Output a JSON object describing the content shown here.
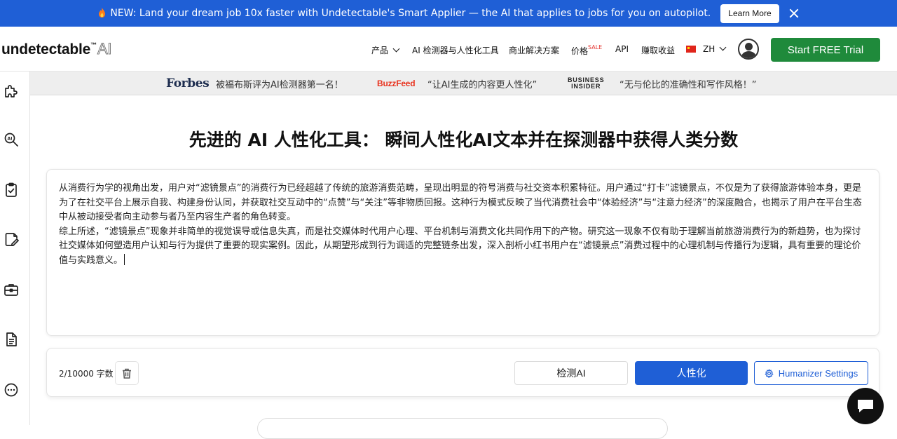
{
  "announcement": {
    "text": "NEW: Land your dream job 10x faster with Undetectable's Smart Applier — the AI that applies to jobs for you on autopilot.",
    "learn_more": "Learn More"
  },
  "header": {
    "logo_main": "undetectable",
    "logo_tm": "™",
    "logo_ai": "AI",
    "nav": {
      "products": "产品",
      "ai_tools": "AI 检测器与人性化工具",
      "business": "商业解决方案",
      "pricing": "价格",
      "sale": "SALE",
      "api": "API",
      "earn": "赚取收益",
      "lang": "ZH"
    },
    "trial_button": "Start FREE Trial"
  },
  "press": {
    "forbes_logo": "Forbes",
    "forbes_quote": "被福布斯评为AI检测器第一名！",
    "buzzfeed_logo": "BuzzFeed",
    "buzzfeed_quote": "“让AI生成的内容更人性化”",
    "bi_logo_line1": "BUSINESS",
    "bi_logo_line2": "INSIDER",
    "bi_quote": "“无与伦比的准确性和写作风格！”"
  },
  "main": {
    "title": "先进的 AI 人性化工具： 瞬间人性化AI文本并在探测器中获得人类分数",
    "editor_text_p1": "从消费行为学的视角出发，用户对“滤镜景点”的消费行为已经超越了传统的旅游消费范畴，呈现出明显的符号消费与社交资本积累特征。用户通过“打卡”滤镜景点，不仅是为了获得旅游体验本身，更是为了在社交平台上展示自我、构建身份认同，并获取社交互动中的“点赞”与“关注”等非物质回报。这种行为模式反映了当代消费社会中“体验经济”与“注意力经济”的深度融合，也揭示了用户在平台生态中从被动接受者向主动参与者乃至内容生产者的角色转变。",
    "editor_text_p2": "综上所述，“滤镜景点”现象并非简单的视觉误导或信息失真，而是社交媒体时代用户心理、平台机制与消费文化共同作用下的产物。研究这一现象不仅有助于理解当前旅游消费行为的新趋势，也为探讨社交媒体如何塑造用户认知与行为提供了重要的现实案例。因此，从期望形成到行为调适的完整链条出发，深入剖析小红书用户在“滤镜景点”消费过程中的心理机制与传播行为逻辑，具有重要的理论价值与实践意义。"
  },
  "toolbar": {
    "count": "2/10000 字数",
    "detect": "检测AI",
    "humanize": "人性化",
    "settings": "Humanizer Settings"
  },
  "icons": {
    "sidebar": [
      "puzzle-icon",
      "ai-search-icon",
      "checklist-icon",
      "edit-document-icon",
      "briefcase-icon",
      "document-icon",
      "more-icon"
    ],
    "toolbar": [
      "trash-icon",
      "gear-icon"
    ],
    "chat": "chat-icon"
  },
  "colors": {
    "announcement_bg": "#1f5fd6",
    "primary_blue": "#1f5fd6",
    "trial_green": "#1f8a3b"
  }
}
